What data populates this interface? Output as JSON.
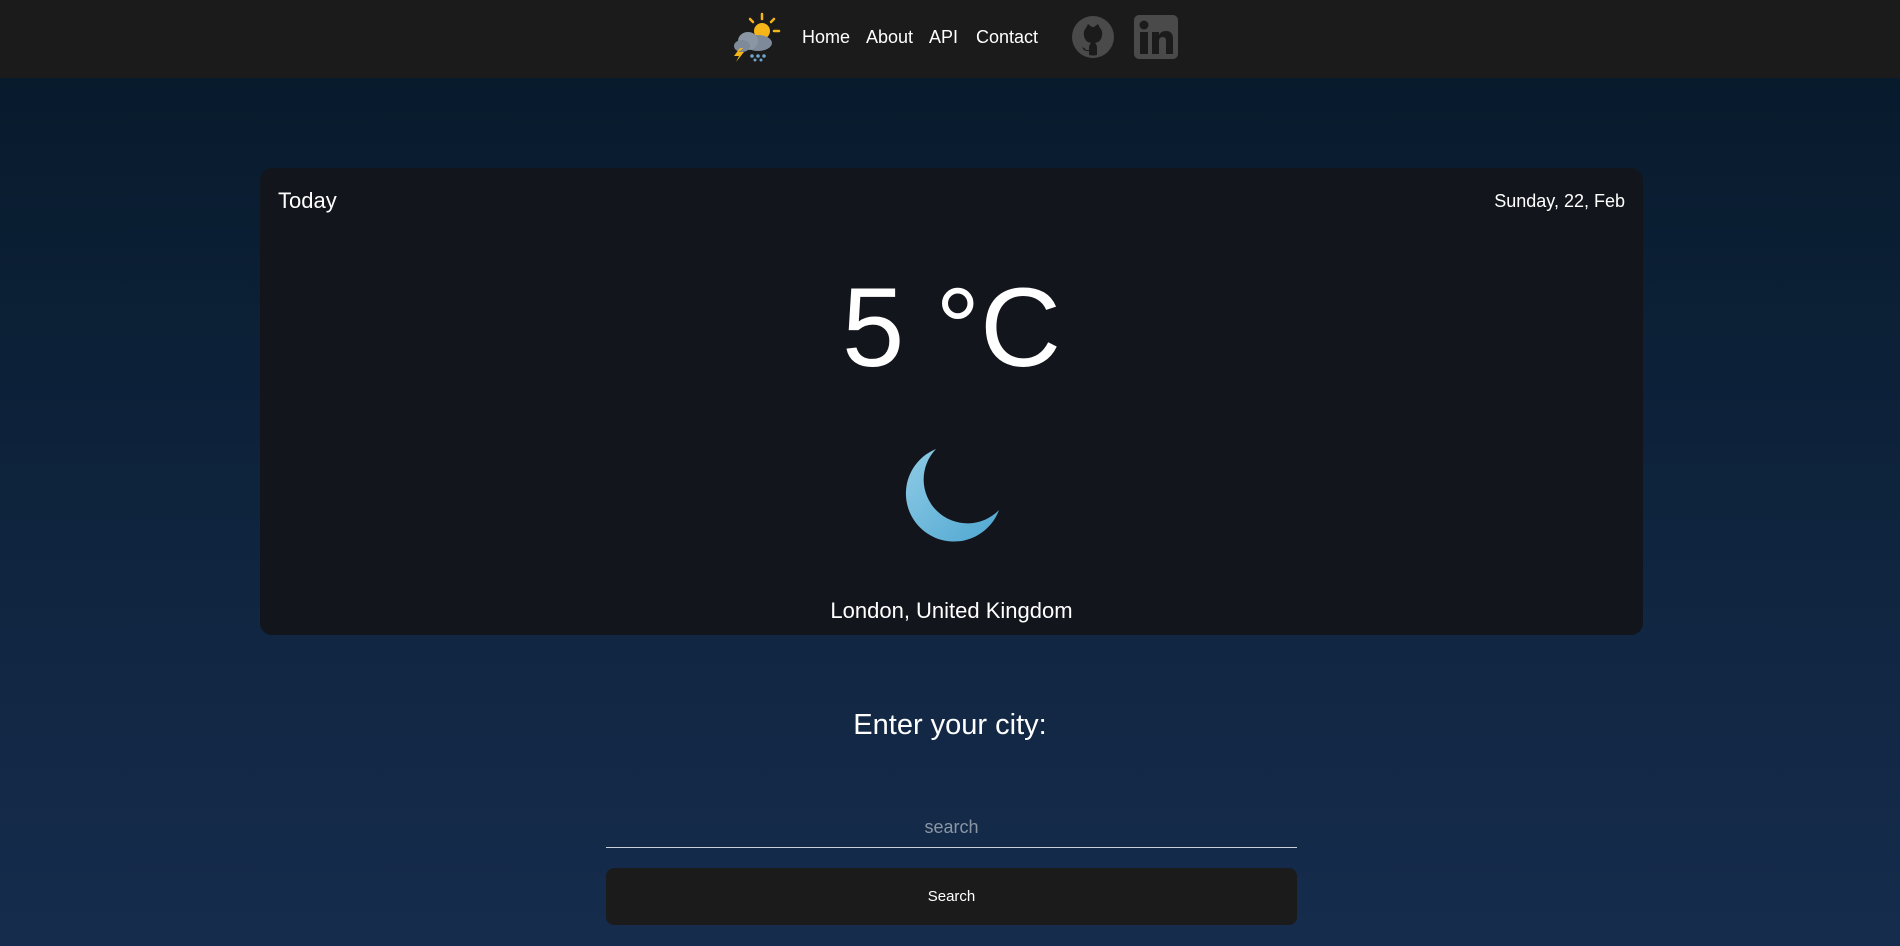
{
  "navbar": {
    "logo_icon": "weather-storm-sun-icon",
    "links": [
      {
        "label": "Home"
      },
      {
        "label": "About"
      },
      {
        "label": "API"
      },
      {
        "label": "Contact"
      }
    ],
    "social": {
      "github_icon": "github-icon",
      "linkedin_icon": "linkedin-icon"
    }
  },
  "card": {
    "today_label": "Today",
    "date": "Sunday, 22, Feb",
    "temperature": "5 °C",
    "condition_icon": "moon-icon",
    "location": "London, United Kingdom"
  },
  "search": {
    "prompt": "Enter your city:",
    "placeholder": "search",
    "value": "",
    "button_label": "Search"
  },
  "colors": {
    "navbar_bg": "#1b1b1b",
    "card_bg": "#12151b",
    "moon": "#6bb7d9",
    "github_icon": "#4a4a4a",
    "linkedin_icon": "#4a4a4a",
    "sun": "#f5b518"
  }
}
